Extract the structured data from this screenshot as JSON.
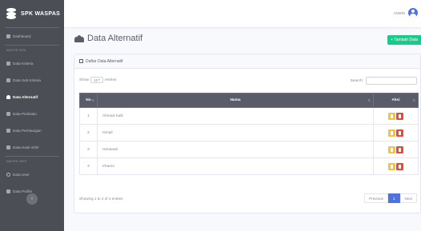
{
  "brand": {
    "name": "SPK WASPAS"
  },
  "sidebar": {
    "dashboard": "Dashboard",
    "heading_master": "MASTER DATA",
    "items": [
      {
        "label": "Data Kriteria"
      },
      {
        "label": "Data Sub Kriteria"
      },
      {
        "label": "Data Alternatif"
      },
      {
        "label": "Data Penilaian"
      },
      {
        "label": "Data Perhitungan"
      },
      {
        "label": "Data Hasil Akhir"
      }
    ],
    "heading_user": "MASTER USER",
    "user_items": [
      {
        "label": "Data User"
      },
      {
        "label": "Data Profile"
      }
    ],
    "toggle_glyph": "‹"
  },
  "topbar": {
    "user_name": "ADMIN"
  },
  "page": {
    "title": "Data Alternatif",
    "add_button": "+ Tambah Data"
  },
  "card": {
    "header": "Daftar Data Alternatif",
    "show_label": "Show",
    "entries_value": "10",
    "entries_label": "entries",
    "search_label": "Search:",
    "search_value": ""
  },
  "table": {
    "headers": {
      "no": "No",
      "nama": "Nama",
      "aksi": "Aksi"
    },
    "rows": [
      {
        "no": "1",
        "nama": "Ahmad Kalli"
      },
      {
        "no": "2",
        "nama": "Ismail"
      },
      {
        "no": "3",
        "nama": "Herawati"
      },
      {
        "no": "4",
        "nama": "Irhams"
      }
    ]
  },
  "footer": {
    "info": "Showing 1 to 4 of 4 entries",
    "prev": "Previous",
    "page": "1",
    "next": "Next"
  },
  "colors": {
    "sidebar": "#4b4e55",
    "accent": "#4e73df",
    "add": "#1cc88a",
    "edit": "#f6c23e",
    "delete": "#e74a3b",
    "table_head": "#5a5c69"
  }
}
